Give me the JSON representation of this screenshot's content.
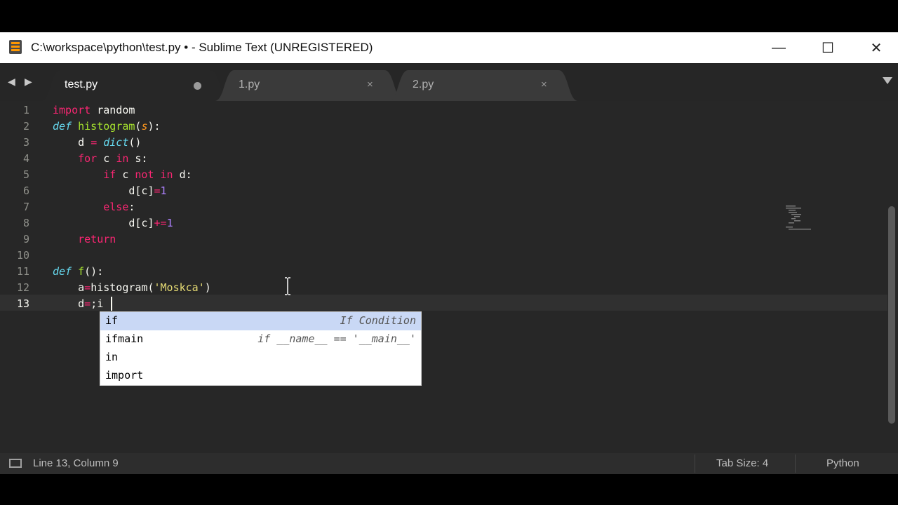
{
  "window": {
    "title": "C:\\workspace\\python\\test.py • - Sublime Text (UNREGISTERED)",
    "minimize": "—",
    "maximize": "☐",
    "close": "✕"
  },
  "nav": {
    "back": "◀",
    "forward": "▶"
  },
  "tabs": [
    {
      "label": "test.py",
      "active": true,
      "dirty": true
    },
    {
      "label": "1.py",
      "active": false,
      "close": "×"
    },
    {
      "label": "2.py",
      "active": false,
      "close": "×"
    }
  ],
  "editor": {
    "line_numbers": [
      "1",
      "2",
      "3",
      "4",
      "5",
      "6",
      "7",
      "8",
      "9",
      "10",
      "11",
      "12",
      "13"
    ],
    "current_line": 13,
    "tokens": {
      "l1": [
        "import",
        " random"
      ],
      "l2": [
        "def",
        " ",
        "histogram",
        "(",
        "s",
        "):"
      ],
      "l3": [
        "    d ",
        "=",
        " ",
        "dict",
        "()"
      ],
      "l4": [
        "    ",
        "for",
        " c ",
        "in",
        " s:"
      ],
      "l5": [
        "        ",
        "if",
        " c ",
        "not",
        " ",
        "in",
        " d:"
      ],
      "l6": [
        "            d[c]",
        "=",
        "1"
      ],
      "l7": [
        "        ",
        "else",
        ":"
      ],
      "l8": [
        "            d[c]",
        "+=",
        "1"
      ],
      "l9": [
        "    ",
        "return"
      ],
      "l11": [
        "def",
        " ",
        "f",
        "():"
      ],
      "l12": [
        "    a",
        "=",
        "histogram(",
        "'Moskca'",
        ")"
      ],
      "l13": [
        "    d",
        "=",
        ";i"
      ]
    }
  },
  "autocomplete": [
    {
      "trigger": "if",
      "annotation": "If Condition",
      "selected": true
    },
    {
      "trigger": "ifmain",
      "annotation": "if __name__ == '__main__'",
      "selected": false
    },
    {
      "trigger": "in",
      "annotation": "",
      "selected": false
    },
    {
      "trigger": "import",
      "annotation": "",
      "selected": false
    }
  ],
  "status": {
    "position": "Line 13, Column 9",
    "tab_size": "Tab Size: 4",
    "syntax": "Python"
  },
  "colors": {
    "keyword": "#f92672",
    "storage": "#66d9ef",
    "function": "#a6e22e",
    "parameter": "#fd971f",
    "number": "#ae81ff",
    "string": "#e6db74",
    "background": "#272727"
  }
}
